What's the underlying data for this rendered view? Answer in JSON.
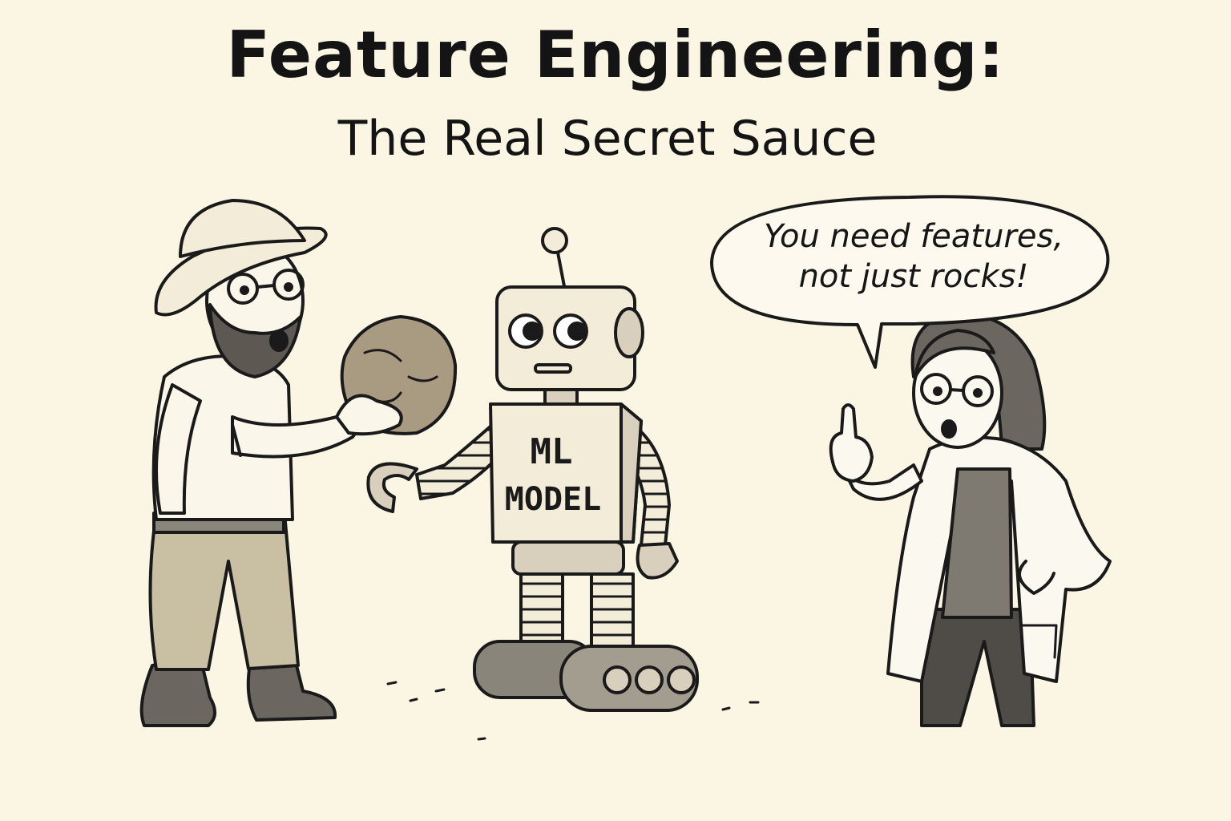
{
  "title": "Feature Engineering:",
  "subtitle": "The Real Secret Sauce",
  "speech": {
    "line1": "You need features,",
    "line2": "not just rocks!"
  },
  "robot": {
    "label_line1": "ML",
    "label_line2": "MODEL"
  },
  "colors": {
    "background": "#fbf5e4",
    "ink": "#1a1a1a",
    "khaki": "#c9c0a3",
    "rock": "#a89b82",
    "boots": "#6b6760",
    "robot_shade": "#d8d0bd"
  }
}
